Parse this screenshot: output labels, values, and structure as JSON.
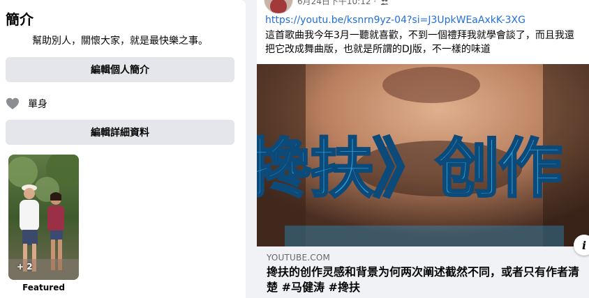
{
  "intro": {
    "title": "簡介",
    "bio": "幫助別人，關懷大家，就是最快樂之事。",
    "edit_bio_button": "編輯個人簡介",
    "relationship": "單身",
    "edit_details_button": "編輯詳細資料",
    "featured": {
      "count_label": "+ 2",
      "label": "Featured"
    }
  },
  "post": {
    "meta_date": "6月24日下午10:12 ·",
    "link": "https://youtu.be/ksnrn9yz-04?si=J3UpkWEaAxkK-3XG",
    "text_lines": [
      "這首歌曲我今年3月一聽就喜歡，不到一個禮拜我就學會談了，而且我還",
      "把它改成舞曲版，也就是所謂的DJ版，不一樣的味道"
    ],
    "preview": {
      "overlay_text": "搀扶》创作",
      "domain": "YOUTUBE.COM",
      "title": "搀扶的创作灵感和背景为何两次阐述截然不同，或者只有作者清楚 #马健涛 #搀扶"
    },
    "info_button_label": "i"
  },
  "colors": {
    "link": "#216fdb",
    "button_bg": "#e4e6eb",
    "page_bg": "#f0f2f5",
    "overlay_text": "#29a4df"
  }
}
